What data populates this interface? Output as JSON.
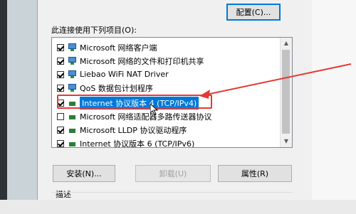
{
  "configure_button": "配置(C)...",
  "list_label": "此连接使用下列项目(O):",
  "items": [
    {
      "label": "Microsoft 网络客户端",
      "checked": true,
      "icon": "network-client-icon",
      "selected": false
    },
    {
      "label": "Microsoft 网络的文件和打印机共享",
      "checked": true,
      "icon": "network-client-icon",
      "selected": false
    },
    {
      "label": "Liebao WiFi NAT Driver",
      "checked": true,
      "icon": "network-client-icon",
      "selected": false
    },
    {
      "label": "QoS 数据包计划程序",
      "checked": true,
      "icon": "network-client-icon",
      "selected": false
    },
    {
      "label": "Internet 协议版本 4 (TCP/IPv4)",
      "checked": true,
      "icon": "protocol-icon",
      "selected": true
    },
    {
      "label": "Microsoft 网络适配器多路传送器协议",
      "checked": false,
      "icon": "protocol-icon",
      "selected": false
    },
    {
      "label": "Microsoft LLDP 协议驱动程序",
      "checked": true,
      "icon": "protocol-icon",
      "selected": false
    },
    {
      "label": "Internet 协议版本 6 (TCP/IPv6)",
      "checked": true,
      "icon": "protocol-icon",
      "selected": false
    }
  ],
  "install_button": "安装(N)...",
  "uninstall_button": "卸载(U)",
  "properties_button": "属性(R)",
  "description_label": "描述",
  "highlight_color": "#e53935"
}
